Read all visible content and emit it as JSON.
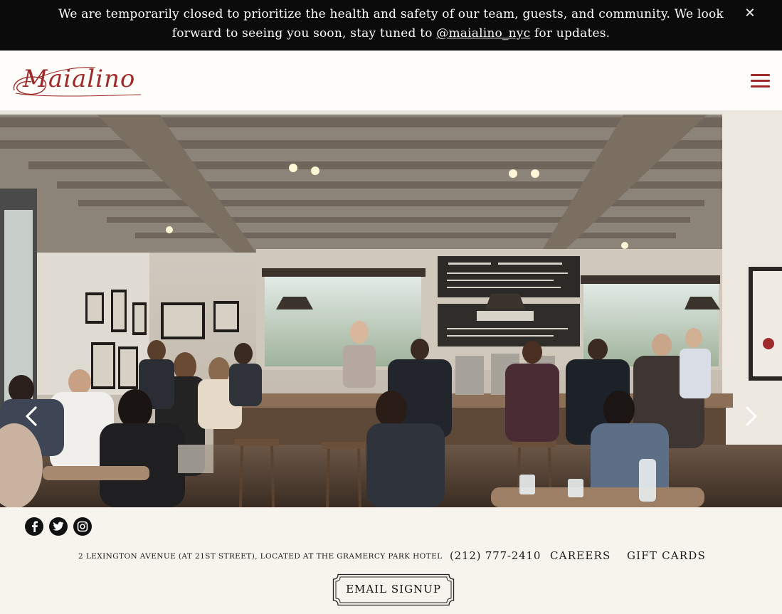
{
  "banner": {
    "line1": "We are temporarily closed to prioritize the health and safety of our team, guests, and community. We look",
    "line2_pre": "forward to seeing you soon, stay tuned to ",
    "line2_link": "@maialino_nyc",
    "line2_post": " for updates.",
    "close_icon": "close-icon"
  },
  "header": {
    "logo_text": "Maialino",
    "menu_icon": "hamburger-menu-icon",
    "brand_color": "#9e2a2b"
  },
  "hero": {
    "prev_icon": "chevron-left-icon",
    "next_icon": "chevron-right-icon"
  },
  "footer": {
    "social": [
      "facebook-icon",
      "twitter-icon",
      "instagram-icon"
    ],
    "address": "2 Lexington Avenue (at 21st Street), located at the Gramercy Park Hotel",
    "phone": "(212) 777-2410",
    "careers": "CAREERS",
    "gift_cards": "GIFT CARDS",
    "email_signup": "EMAIL SIGNUP"
  }
}
